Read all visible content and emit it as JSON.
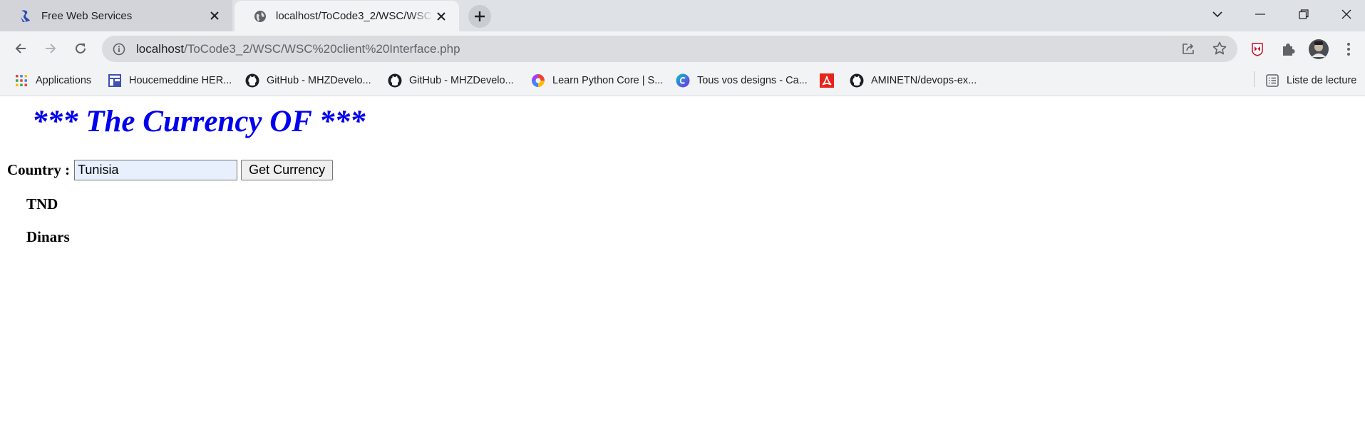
{
  "browser": {
    "tabs": [
      {
        "title": "Free Web Services",
        "icon": "service-logo-icon",
        "active": false
      },
      {
        "title": "localhost/ToCode3_2/WSC/WSC client Interface.php",
        "icon": "globe-icon",
        "active": true
      }
    ],
    "address": {
      "host": "localhost",
      "path": "/ToCode3_2/WSC/WSC%20client%20Interface.php"
    },
    "bookmarks": [
      {
        "label": "Applications",
        "icon": "apps-grid-icon"
      },
      {
        "label": "Houcemeddine HER...",
        "icon": "page-layout-icon"
      },
      {
        "label": "GitHub - MHZDevelo...",
        "icon": "github-icon"
      },
      {
        "label": "GitHub - MHZDevelo...",
        "icon": "github-icon"
      },
      {
        "label": "Learn Python Core | S...",
        "icon": "colorful-swirl-icon"
      },
      {
        "label": "Tous vos designs - Ca...",
        "icon": "canva-icon"
      },
      {
        "label": "",
        "icon": "acrobat-icon"
      },
      {
        "label": "AMINETN/devops-ex...",
        "icon": "github-icon"
      }
    ],
    "reading_list_label": "Liste de lecture"
  },
  "page": {
    "heading": "*** The Currency OF ***",
    "country_label": "Country :",
    "country_value": "Tunisia",
    "button_label": "Get Currency",
    "currency_code": "TND",
    "currency_name": "Dinars"
  },
  "colors": {
    "heading": "#0000ee",
    "tabstrip_bg": "#dee1e6",
    "toolbar_bg": "#f1f3f4",
    "omnibox_bg": "#dadce0",
    "input_bg": "#e8f0fe"
  }
}
